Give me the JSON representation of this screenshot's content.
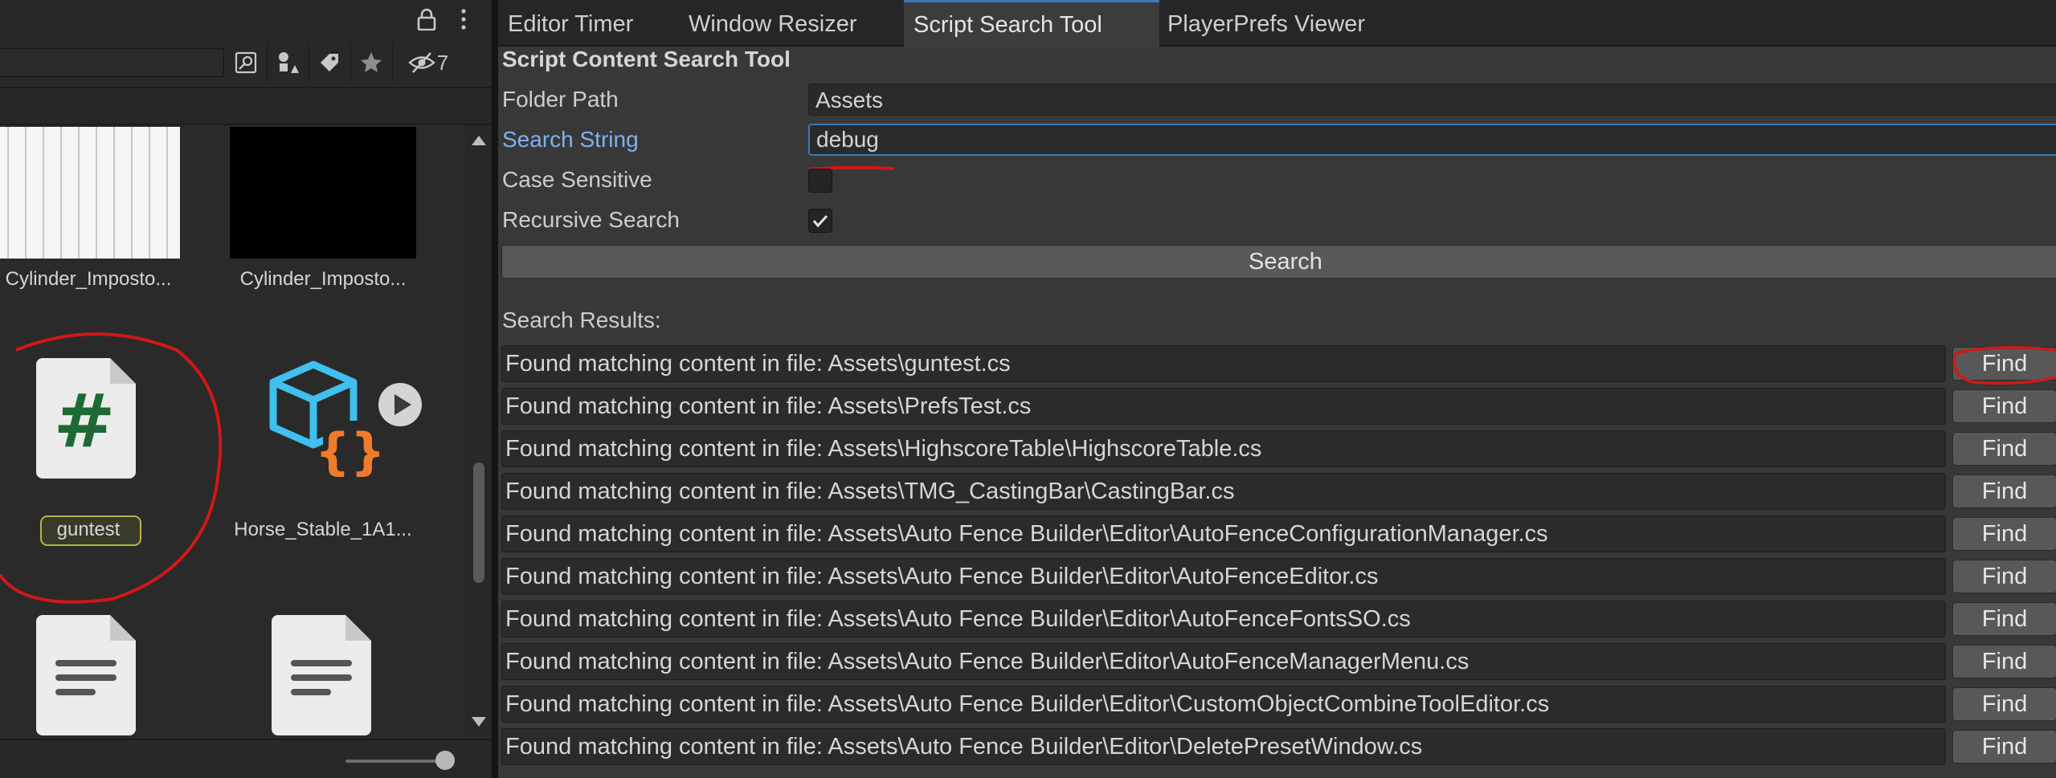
{
  "left_panel": {
    "hidden_count": "7",
    "tiles": [
      {
        "label": "Cylinder_Imposto..."
      },
      {
        "label": "Cylinder_Imposto..."
      },
      {
        "label": "guntest"
      },
      {
        "label": "Horse_Stable_1A1..."
      },
      {
        "label": ""
      },
      {
        "label": ""
      }
    ]
  },
  "tabs": [
    {
      "label": "Editor Timer"
    },
    {
      "label": "Window Resizer"
    },
    {
      "label": "Script Search Tool"
    },
    {
      "label": "PlayerPrefs Viewer"
    }
  ],
  "tool": {
    "title": "Script Content Search Tool",
    "folder_path_label": "Folder Path",
    "folder_path_value": "Assets",
    "search_string_label": "Search String",
    "search_string_value": "debug",
    "case_sensitive_label": "Case Sensitive",
    "case_sensitive_checked": false,
    "recursive_label": "Recursive Search",
    "recursive_checked": true,
    "search_button": "Search",
    "results_label": "Search Results:"
  },
  "results": [
    {
      "text": "Found matching content in file: Assets\\guntest.cs",
      "button": "Find"
    },
    {
      "text": "Found matching content in file: Assets\\PrefsTest.cs",
      "button": "Find"
    },
    {
      "text": "Found matching content in file: Assets\\HighscoreTable\\HighscoreTable.cs",
      "button": "Find"
    },
    {
      "text": "Found matching content in file: Assets\\TMG_CastingBar\\CastingBar.cs",
      "button": "Find"
    },
    {
      "text": "Found matching content in file: Assets\\Auto Fence Builder\\Editor\\AutoFenceConfigurationManager.cs",
      "button": "Find"
    },
    {
      "text": "Found matching content in file: Assets\\Auto Fence Builder\\Editor\\AutoFenceEditor.cs",
      "button": "Find"
    },
    {
      "text": "Found matching content in file: Assets\\Auto Fence Builder\\Editor\\AutoFenceFontsSO.cs",
      "button": "Find"
    },
    {
      "text": "Found matching content in file: Assets\\Auto Fence Builder\\Editor\\AutoFenceManagerMenu.cs",
      "button": "Find"
    },
    {
      "text": "Found matching content in file: Assets\\Auto Fence Builder\\Editor\\CustomObjectCombineToolEditor.cs",
      "button": "Find"
    },
    {
      "text": "Found matching content in file: Assets\\Auto Fence Builder\\Editor\\DeletePresetWindow.cs",
      "button": "Find"
    }
  ],
  "colors": {
    "accent": "#3a79bb",
    "annotation": "#d01818"
  }
}
